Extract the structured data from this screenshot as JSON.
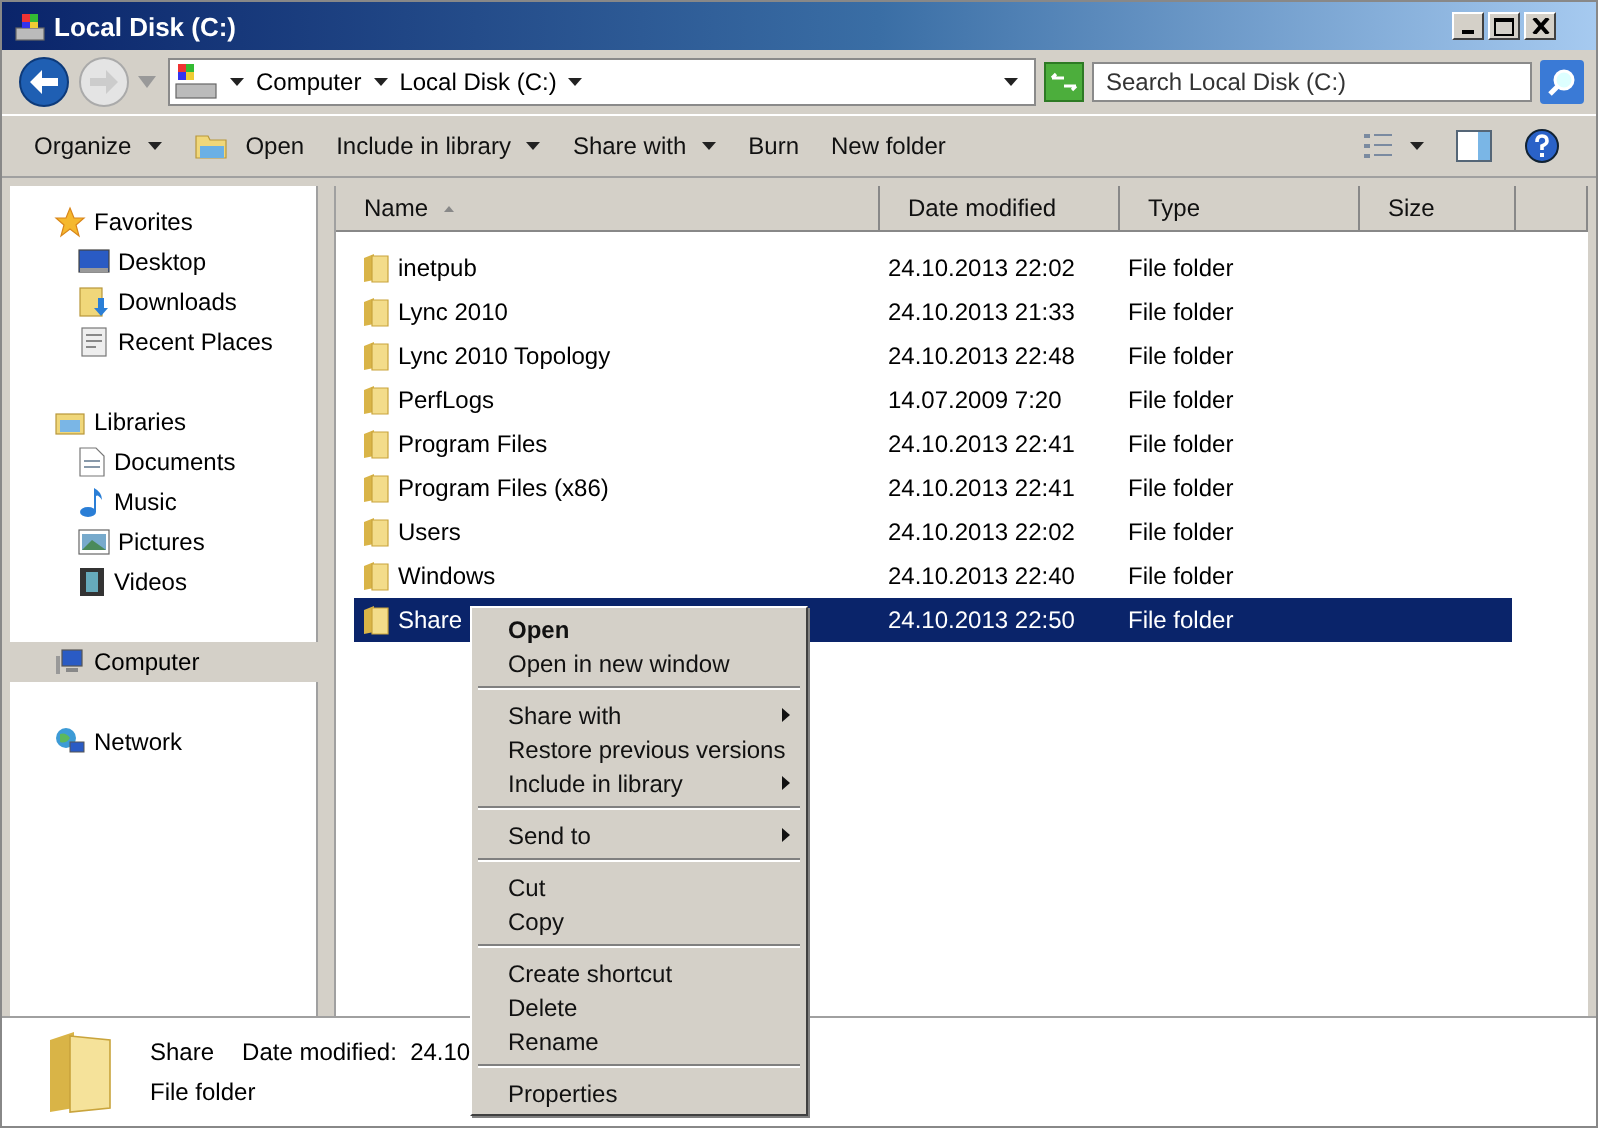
{
  "window": {
    "title": "Local Disk (C:)"
  },
  "address": {
    "crumbs": [
      "Computer",
      "Local Disk (C:)"
    ]
  },
  "search": {
    "placeholder": "Search Local Disk (C:)"
  },
  "toolbar": [
    {
      "label": "Organize",
      "dropdown": true
    },
    {
      "label": "Open",
      "dropdown": false
    },
    {
      "label": "Include in library",
      "dropdown": true
    },
    {
      "label": "Share with",
      "dropdown": true
    },
    {
      "label": "Burn",
      "dropdown": false
    },
    {
      "label": "New folder",
      "dropdown": false
    }
  ],
  "sidebar": {
    "sections": [
      {
        "label": "Favorites",
        "selected": false,
        "children": [
          {
            "label": "Desktop",
            "selected": false
          },
          {
            "label": "Downloads",
            "selected": false
          },
          {
            "label": "Recent Places",
            "selected": false
          }
        ]
      },
      {
        "label": "Libraries",
        "selected": false,
        "children": [
          {
            "label": "Documents",
            "selected": false
          },
          {
            "label": "Music",
            "selected": false
          },
          {
            "label": "Pictures",
            "selected": false
          },
          {
            "label": "Videos",
            "selected": false
          }
        ]
      },
      {
        "label": "Computer",
        "selected": true
      },
      {
        "label": "Network",
        "selected": false
      }
    ]
  },
  "table": {
    "columns": [
      {
        "label": "Name",
        "sorted": true
      },
      {
        "label": "Date modified",
        "sorted": false
      },
      {
        "label": "Type",
        "sorted": false
      },
      {
        "label": "Size",
        "sorted": false
      }
    ],
    "rows": [
      {
        "name": "inetpub",
        "date": "24.10.2013 22:02",
        "type": "File folder",
        "selected": false
      },
      {
        "name": "Lync 2010",
        "date": "24.10.2013 21:33",
        "type": "File folder",
        "selected": false
      },
      {
        "name": "Lync 2010 Topology",
        "date": "24.10.2013 22:48",
        "type": "File folder",
        "selected": false
      },
      {
        "name": "PerfLogs",
        "date": "14.07.2009 7:20",
        "type": "File folder",
        "selected": false
      },
      {
        "name": "Program Files",
        "date": "24.10.2013 22:41",
        "type": "File folder",
        "selected": false
      },
      {
        "name": "Program Files (x86)",
        "date": "24.10.2013 22:41",
        "type": "File folder",
        "selected": false
      },
      {
        "name": "Users",
        "date": "24.10.2013 22:02",
        "type": "File folder",
        "selected": false
      },
      {
        "name": "Windows",
        "date": "24.10.2013 22:40",
        "type": "File folder",
        "selected": false
      },
      {
        "name": "Share",
        "date": "24.10.2013 22:50",
        "type": "File folder",
        "selected": true
      }
    ]
  },
  "context_menu": [
    {
      "kind": "item",
      "label": "Open",
      "default": true,
      "submenu": false
    },
    {
      "kind": "item",
      "label": "Open in new window",
      "default": false,
      "submenu": false
    },
    {
      "kind": "separator"
    },
    {
      "kind": "item",
      "label": "Share with",
      "default": false,
      "submenu": true
    },
    {
      "kind": "item",
      "label": "Restore previous versions",
      "default": false,
      "submenu": false
    },
    {
      "kind": "item",
      "label": "Include in library",
      "default": false,
      "submenu": true
    },
    {
      "kind": "separator"
    },
    {
      "kind": "item",
      "label": "Send to",
      "default": false,
      "submenu": true
    },
    {
      "kind": "separator"
    },
    {
      "kind": "item",
      "label": "Cut",
      "default": false,
      "submenu": false
    },
    {
      "kind": "item",
      "label": "Copy",
      "default": false,
      "submenu": false
    },
    {
      "kind": "separator"
    },
    {
      "kind": "item",
      "label": "Create shortcut",
      "default": false,
      "submenu": false
    },
    {
      "kind": "item",
      "label": "Delete",
      "default": false,
      "submenu": false
    },
    {
      "kind": "item",
      "label": "Rename",
      "default": false,
      "submenu": false
    },
    {
      "kind": "separator"
    },
    {
      "kind": "item",
      "label": "Properties",
      "default": false,
      "submenu": false
    }
  ],
  "details": {
    "name": "Share",
    "date": "Date modified:  24.10",
    "type": "File folder"
  }
}
